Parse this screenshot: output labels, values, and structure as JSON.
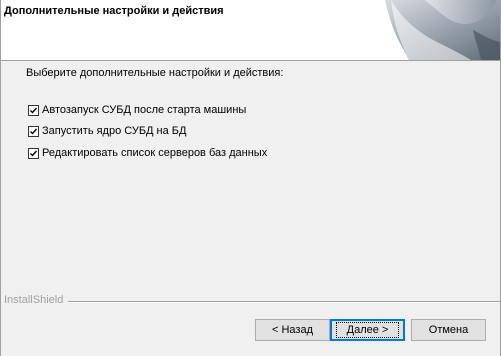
{
  "header": {
    "title": "Дополнительные настройки и действия"
  },
  "main": {
    "prompt": "Выберите дополнительные настройки и действия:",
    "options": [
      {
        "label": "Автозапуск СУБД после старта машины",
        "checked": true
      },
      {
        "label": "Запустить ядро СУБД на БД",
        "checked": true
      },
      {
        "label": "Редактировать список серверов баз данных",
        "checked": true
      }
    ]
  },
  "footer": {
    "brand": "InstallShield",
    "back_label": "< Назад",
    "next_label": "Далее >",
    "cancel_label": "Отмена"
  },
  "colors": {
    "accent": "#0078d7",
    "background": "#f0f0f0"
  }
}
